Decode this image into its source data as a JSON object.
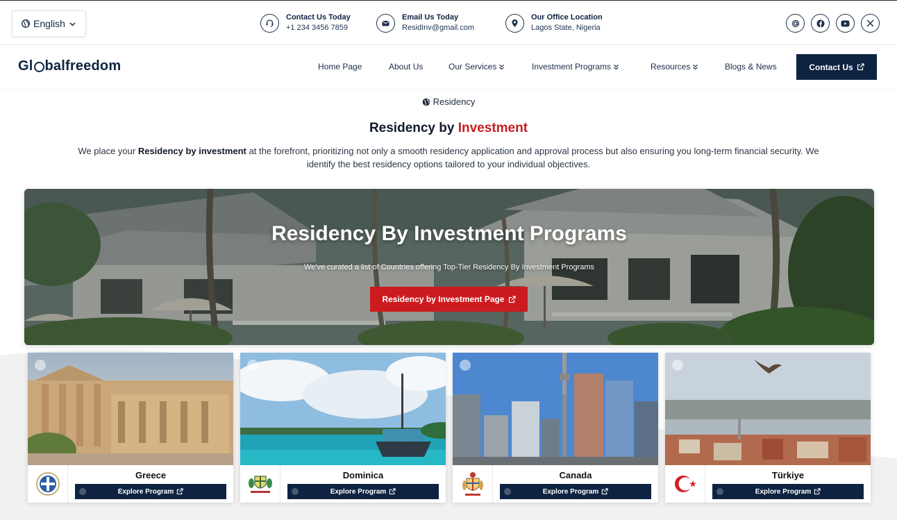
{
  "language": {
    "label": "English",
    "icon": "globe-icon"
  },
  "contacts": [
    {
      "title": "Contact Us Today",
      "value": "+1 234 3456 7859",
      "icon": "headset-icon"
    },
    {
      "title": "Email Us Today",
      "value": "ResidInv@gmail.com",
      "icon": "mail-icon"
    },
    {
      "title": "Our Office Location",
      "value": "Lagos State, Nigeria",
      "icon": "location-pin-icon"
    }
  ],
  "social_icons": [
    "at-sign-icon",
    "facebook-icon",
    "youtube-icon",
    "x-icon"
  ],
  "logo": {
    "before": "Gl",
    "after": "balfreedom"
  },
  "nav": {
    "items": [
      {
        "label": "Home Page"
      },
      {
        "label": "About Us"
      },
      {
        "label": "Our Services",
        "has_dropdown": true
      },
      {
        "label": "Investment Programs",
        "has_dropdown": true
      },
      {
        "label": "Resources",
        "has_dropdown": true
      },
      {
        "label": "Blogs & News"
      }
    ],
    "cta_label": "Contact Us"
  },
  "section": {
    "tag": "Residency",
    "title_plain": "Residency by ",
    "title_accent": "Investment",
    "desc_before": "We place your ",
    "desc_bold": "Residency by investment",
    "desc_after": " at the forefront, prioritizing not only a smooth residency application and approval process but also ensuring you long-term financial security. We identify the best residency options tailored to your individual objectives."
  },
  "hero": {
    "title": "Residency By Investment Programs",
    "subtitle": "We've curated a list of Countries offering Top-Tier Residency By Investment Programs",
    "button_label": "Residency by Investment Page"
  },
  "countries": [
    {
      "name": "Greece",
      "button_label": "Explore Program"
    },
    {
      "name": "Dominica",
      "button_label": "Explore Program"
    },
    {
      "name": "Canada",
      "button_label": "Explore Program"
    },
    {
      "name": "Türkiye",
      "button_label": "Explore Program"
    }
  ],
  "colors": {
    "navy": "#0d2341",
    "accent_red": "#cc1b1f",
    "title_red": "#c91d22"
  }
}
